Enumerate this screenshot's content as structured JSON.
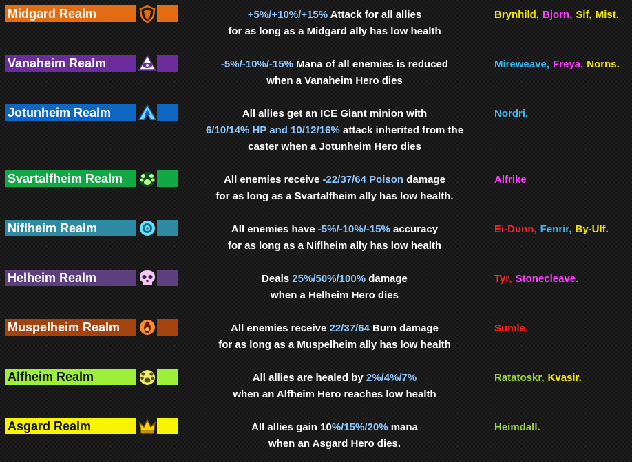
{
  "realms": [
    {
      "name": "Midgard Realm",
      "color": "#e26c12",
      "text_color": "#ffffff",
      "icon": "shield-icon",
      "description": {
        "line1": {
          "hl": "+5%/+10%/+15%",
          "text": " Attack for all allies"
        },
        "line2": "for as long as a Midgard ally has low health"
      },
      "heroes": [
        {
          "name": "Brynhild,",
          "color": "#f2e600"
        },
        {
          "name": "Bjorn,",
          "color": "#ff3cff"
        },
        {
          "name": "Sif,",
          "color": "#f2e600"
        },
        {
          "name": "Mist.",
          "color": "#f2e600"
        }
      ]
    },
    {
      "name": "Vanaheim Realm",
      "color": "#6a2d9b",
      "text_color": "#ffffff",
      "icon": "eye-icon",
      "description": {
        "line1": {
          "hl": "-5%/-10%/-15%",
          "text": " Mana of all enemies is reduced"
        },
        "line2": "when a Vanaheim Hero dies"
      },
      "heroes": [
        {
          "name": "Mireweave,",
          "color": "#3ab8f0"
        },
        {
          "name": "Freya,",
          "color": "#ff3cff"
        },
        {
          "name": "Norns.",
          "color": "#f2e600"
        }
      ]
    },
    {
      "name": "Jotunheim Realm",
      "color": "#0d66c2",
      "text_color": "#ffffff",
      "icon": "mountain-icon",
      "description": {
        "line1": "All allies get an ICE Giant minion with",
        "line2": {
          "hl": "6/10/14% HP and 10/12/16%",
          "text": " attack inherited from the"
        },
        "line3": "caster when a Jotunheim Hero dies"
      },
      "heroes": [
        {
          "name": "Nordri.",
          "color": "#3ab8f0"
        }
      ]
    },
    {
      "name": "Svartalfheim Realm",
      "color": "#12a845",
      "text_color": "#ffffff",
      "icon": "paw-icon",
      "description": {
        "line1": {
          "pre": "All enemies receive ",
          "hl": "-22/37/64 Poison",
          "text": " damage"
        },
        "line2": "for as long as a Svartalfheim ally has low health."
      },
      "heroes": [
        {
          "name": "Alfrike",
          "color": "#ff3cff"
        }
      ]
    },
    {
      "name": "Niflheim Realm",
      "color": "#2e8aa3",
      "text_color": "#ffffff",
      "icon": "swirl-icon",
      "description": {
        "line1": {
          "pre": "All enemies have ",
          "hl": "-5%/-10%/-15%",
          "text": " accuracy"
        },
        "line2": "for as long as a Niflheim ally has low health"
      },
      "heroes": [
        {
          "name": "Ei-Dunn,",
          "color": "#ff2222"
        },
        {
          "name": "Fenrir,",
          "color": "#3ab8f0"
        },
        {
          "name": "By-Ulf.",
          "color": "#f2e600"
        }
      ]
    },
    {
      "name": "Helheim Realm",
      "color": "#5e3f7e",
      "text_color": "#ffffff",
      "icon": "skull-icon",
      "description": {
        "line1": {
          "pre": "Deals ",
          "hl": "25%/50%/100%",
          "text": " damage"
        },
        "line2": "when a Helheim Hero dies"
      },
      "heroes": [
        {
          "name": "Tyr,",
          "color": "#ff2222"
        },
        {
          "name": "Stonecleave.",
          "color": "#ff3cff"
        }
      ]
    },
    {
      "name": "Muspelheim Realm",
      "color": "#a4430e",
      "text_color": "#ffffff",
      "icon": "flame-icon",
      "description": {
        "line1": {
          "pre": "All enemies receive ",
          "hl": "22/37/64",
          "text": " Burn damage"
        },
        "line2": "for as long as a Muspelheim ally has low health"
      },
      "heroes": [
        {
          "name": "Sumle.",
          "color": "#ff2222"
        }
      ]
    },
    {
      "name": "Alfheim Realm",
      "color": "#9cf03a",
      "text_color": "#111111",
      "icon": "leaf-paw-icon",
      "description": {
        "line1": {
          "pre": "All allies are healed by ",
          "hl": "2%/4%/7%",
          "text": ""
        },
        "line2": "when an Alfheim Hero reaches low health"
      },
      "heroes": [
        {
          "name": "Ratatoskr,",
          "color": "#9cd33a"
        },
        {
          "name": "Kvasir.",
          "color": "#f2e600"
        }
      ]
    },
    {
      "name": "Asgard Realm",
      "color": "#f8f400",
      "text_color": "#111111",
      "icon": "crown-icon",
      "description": {
        "line1": {
          "pre": "All allies gain 10",
          "hl": "%/15%/20%",
          "text": " mana"
        },
        "line2": "when an Asgard Hero dies."
      },
      "heroes": [
        {
          "name": "Heimdall.",
          "color": "#9cd33a"
        }
      ]
    }
  ]
}
